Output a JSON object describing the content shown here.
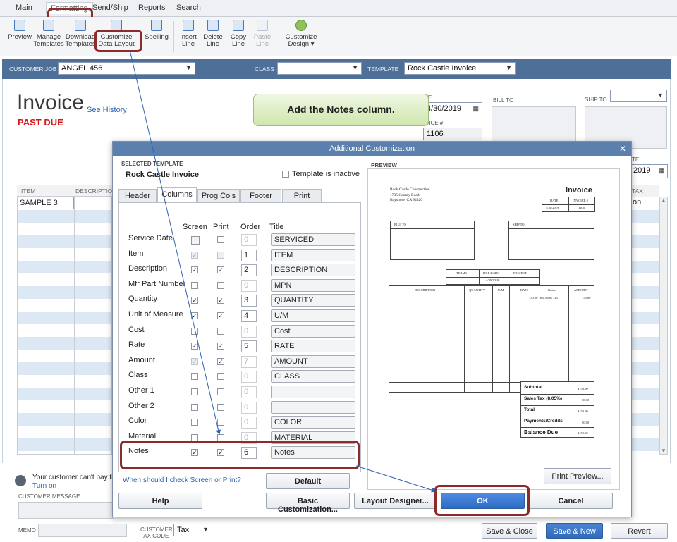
{
  "ribbon": {
    "menu": [
      "Main",
      "Formatting",
      "Send/Ship",
      "Reports",
      "Search"
    ],
    "buttons": [
      {
        "label": "Preview",
        "icon": "preview-icon"
      },
      {
        "label": "Manage Templates",
        "icon": "manage-templates-icon"
      },
      {
        "label": "Download Templates",
        "icon": "download-templates-icon"
      },
      {
        "label": "Customize Data Layout",
        "icon": "customize-data-layout-icon"
      },
      {
        "label": "Spelling",
        "icon": "spelling-icon"
      },
      {
        "label": "Insert Line",
        "icon": "insert-line-icon"
      },
      {
        "label": "Delete Line",
        "icon": "delete-line-icon"
      },
      {
        "label": "Copy Line",
        "icon": "copy-line-icon"
      },
      {
        "label": "Paste Line",
        "icon": "paste-line-icon"
      },
      {
        "label": "Customize Design",
        "icon": "customize-design-icon"
      }
    ]
  },
  "invoice": {
    "customer_job_label": "CUSTOMER:JOB",
    "customer_job_value": "ANGEL 456",
    "class_label": "CLASS",
    "class_value": "",
    "template_label": "TEMPLATE",
    "template_value": "Rock Castle Invoice",
    "title": "Invoice",
    "see_history": "See History",
    "past_due": "PAST DUE",
    "date_label": "TE",
    "date_value": "4/30/2019",
    "invoice_no_label": "OICE #",
    "invoice_no_value": "1106",
    "bill_to_label": "BILL TO",
    "ship_to_label": "SHIP TO",
    "due_date_label": "TE",
    "due_date_value": "2019",
    "col_item": "ITEM",
    "col_description": "DESCRIPTIO",
    "col_tax": "TAX",
    "row1_item": "SAMPLE 3",
    "row1_tax": "on",
    "pay_note": "Your customer can't pay this",
    "turn_on": "Turn on",
    "customer_message_label": "CUSTOMER MESSAGE",
    "memo_label": "MEMO",
    "customer_tax_code_label": "CUSTOMER TAX CODE",
    "tax_value": "Tax",
    "save_close": "Save & Close",
    "save_new": "Save & New",
    "revert": "Revert"
  },
  "callout": "Add the Notes column.",
  "dialog": {
    "title": "Additional Customization",
    "selected_template_label": "SELECTED TEMPLATE",
    "template_name": "Rock Castle Invoice",
    "inactive_label": "Template is inactive",
    "preview_label": "PREVIEW",
    "tabs": [
      "Header",
      "Columns",
      "Prog Cols",
      "Footer",
      "Print"
    ],
    "col_headers": {
      "screen": "Screen",
      "print": "Print",
      "order": "Order",
      "title": "Title"
    },
    "rows": [
      {
        "name": "Service Date",
        "screen": false,
        "print": false,
        "order": "0",
        "title": "SERVICED",
        "disabled": false
      },
      {
        "name": "Item",
        "screen": true,
        "print": false,
        "order": "1",
        "title": "ITEM",
        "screen_gray": true
      },
      {
        "name": "Description",
        "screen": true,
        "print": true,
        "order": "2",
        "title": "DESCRIPTION"
      },
      {
        "name": "Mfr Part Number",
        "screen": false,
        "print": false,
        "order": "0",
        "title": "MPN"
      },
      {
        "name": "Quantity",
        "screen": true,
        "print": true,
        "order": "3",
        "title": "QUANTITY"
      },
      {
        "name": "Unit of Measure",
        "screen": true,
        "print": true,
        "order": "4",
        "title": "U/M"
      },
      {
        "name": "Cost",
        "screen": false,
        "print": false,
        "order": "0",
        "title": "Cost"
      },
      {
        "name": "Rate",
        "screen": true,
        "print": true,
        "order": "5",
        "title": "RATE"
      },
      {
        "name": "Amount",
        "screen": true,
        "print": true,
        "order": "7",
        "title": "AMOUNT",
        "screen_gray": true
      },
      {
        "name": "Class",
        "screen": false,
        "print": false,
        "order": "0",
        "title": "CLASS"
      },
      {
        "name": "Other 1",
        "screen": false,
        "print": false,
        "order": "0",
        "title": ""
      },
      {
        "name": "Other 2",
        "screen": false,
        "print": false,
        "order": "0",
        "title": ""
      },
      {
        "name": "Color",
        "screen": false,
        "print": false,
        "order": "0",
        "title": "COLOR"
      },
      {
        "name": "Material",
        "screen": false,
        "print": false,
        "order": "0",
        "title": "MATERIAL"
      },
      {
        "name": "Notes",
        "screen": true,
        "print": true,
        "order": "6",
        "title": "Notes"
      }
    ],
    "help_link": "When should I check Screen or Print?",
    "default_btn": "Default",
    "print_preview_btn": "Print Preview...",
    "help_btn": "Help",
    "basic_btn": "Basic Customization...",
    "layout_btn": "Layout Designer...",
    "ok_btn": "OK",
    "cancel_btn": "Cancel",
    "preview": {
      "company": "Rock Castle Construction",
      "addr1": "1735 County Road",
      "addr2": "Bayshore, CA 94326",
      "title": "Invoice",
      "date_h": "DATE",
      "inv_h": "INVOICE #",
      "date_v": "4/30/2019",
      "inv_v": "1106",
      "bill_to": "BILL TO",
      "ship_to": "SHIP TO",
      "terms": "TERMS",
      "due_date": "DUE DATE",
      "project": "PROJECT",
      "due_v": "4/30/2019",
      "cols": [
        "DESCRIPTION",
        "QUANTITY",
        "U/M",
        "RATE",
        "Notes",
        "AMOUNT"
      ],
      "rate_v": "150.00",
      "notes_v": "test notes 123",
      "amount_v": "150.00",
      "subtotal": "Subtotal",
      "subtotal_v": "$150.00",
      "sales_tax": "Sales Tax  (8.05%)",
      "sales_tax_v": "$0.00",
      "total": "Total",
      "total_v": "$150.00",
      "payments": "Payments/Credits",
      "payments_v": "$0.00",
      "balance": "Balance Due",
      "balance_v": "$150.00"
    }
  }
}
